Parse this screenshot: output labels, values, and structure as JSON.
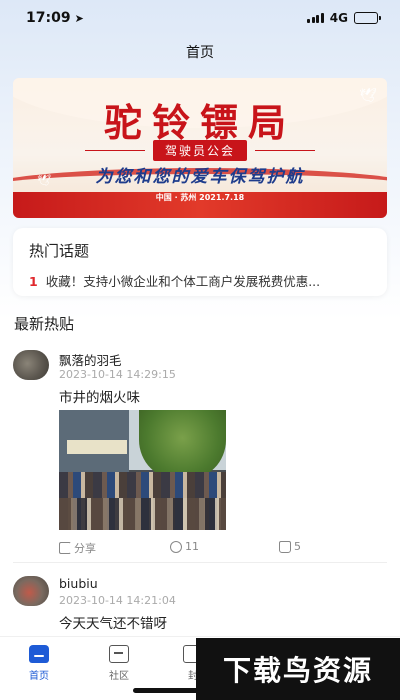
{
  "status_bar": {
    "time": "17:09",
    "network": "4G"
  },
  "header": {
    "title": "首页"
  },
  "banner": {
    "title": "驼铃镖局",
    "subtitle": "驾驶员公会",
    "slogan": "为您和您的爱车保驾护航",
    "date_line": "中国 · 苏州 2021.7.18"
  },
  "hot_topics": {
    "title": "热门话题",
    "items": [
      {
        "rank": "1",
        "text": "收藏！支持小微企业和个体工商户发展税费优惠..."
      }
    ]
  },
  "latest": {
    "title": "最新热贴"
  },
  "posts": [
    {
      "user": "飘落的羽毛",
      "time": "2023-10-14 14:29:15",
      "text": "市井的烟火味",
      "share_label": "分享",
      "comments": "11",
      "likes": "5"
    },
    {
      "user": "biubiu",
      "time": "2023-10-14 14:21:04",
      "text": "今天天气还不错呀"
    }
  ],
  "tabbar": {
    "tabs": [
      {
        "label": "首页",
        "icon": "home-icon"
      },
      {
        "label": "社区",
        "icon": "community-icon"
      },
      {
        "label": "封",
        "icon": "document-icon"
      }
    ]
  },
  "watermark": {
    "text": "下载鸟资源"
  },
  "colors": {
    "accent": "#1e5bd6",
    "hot_rank": "#e0282d",
    "banner_red": "#c8141a"
  }
}
